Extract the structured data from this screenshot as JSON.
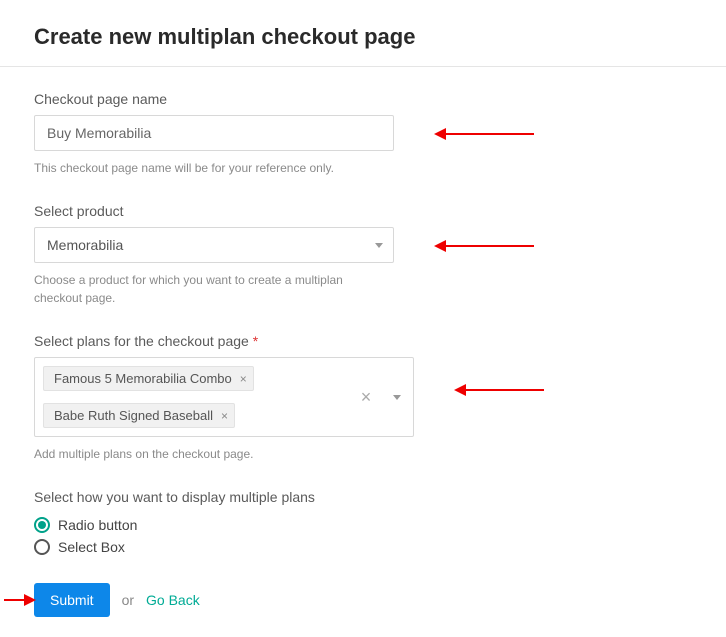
{
  "title": "Create new multiplan checkout page",
  "fields": {
    "pageName": {
      "label": "Checkout page name",
      "value": "Buy Memorabilia",
      "help": "This checkout page name will be for your reference only."
    },
    "product": {
      "label": "Select product",
      "value": "Memorabilia",
      "help": "Choose a product for which you want to create a multiplan checkout page."
    },
    "plans": {
      "label": "Select plans for the checkout page",
      "required_marker": "*",
      "chips": [
        "Famous 5 Memorabilia Combo",
        "Babe Ruth Signed Baseball"
      ],
      "help": "Add multiple plans on the checkout page."
    },
    "display": {
      "label": "Select how you want to display multiple plans",
      "options": [
        {
          "label": "Radio button",
          "selected": true
        },
        {
          "label": "Select Box",
          "selected": false
        }
      ]
    }
  },
  "actions": {
    "submit": "Submit",
    "or": "or",
    "goBack": "Go Back"
  },
  "glyphs": {
    "x": "×",
    "chevron": ""
  }
}
